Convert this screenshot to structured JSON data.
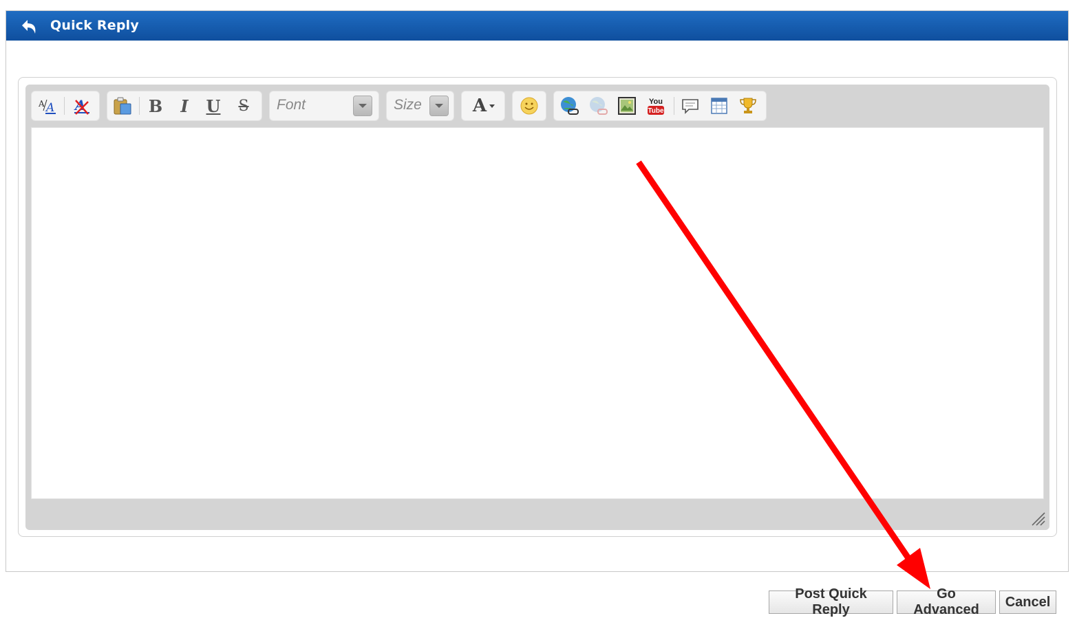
{
  "header": {
    "title": "Quick Reply",
    "icon": "reply-arrow-icon"
  },
  "toolbar": {
    "groups": [
      {
        "items": [
          "font-size-icon",
          "remove-format-icon"
        ]
      },
      {
        "items": [
          "paste-icon",
          "bold-icon",
          "italic-icon",
          "underline-icon",
          "strikethrough-icon"
        ]
      },
      {
        "items": [
          "font-combo"
        ]
      },
      {
        "items": [
          "size-combo"
        ]
      },
      {
        "items": [
          "text-color-icon"
        ]
      },
      {
        "items": [
          "smiley-icon"
        ]
      },
      {
        "items": [
          "link-icon",
          "unlink-icon",
          "image-icon",
          "youtube-icon",
          "quote-icon",
          "table-icon",
          "trophy-icon"
        ]
      }
    ],
    "bold_label": "B",
    "italic_label": "I",
    "underline_label": "U",
    "strike_label": "S",
    "font_placeholder": "Font",
    "size_placeholder": "Size",
    "color_label": "A",
    "youtube_top": "You",
    "youtube_bottom": "Tube"
  },
  "editor": {
    "content": ""
  },
  "buttons": {
    "post": "Post Quick Reply",
    "advanced": "Go Advanced",
    "cancel": "Cancel"
  },
  "colors": {
    "header_bg": "#1a62b8",
    "annotation_arrow": "#ff0000",
    "toolbar_bg": "#d4d4d4"
  }
}
